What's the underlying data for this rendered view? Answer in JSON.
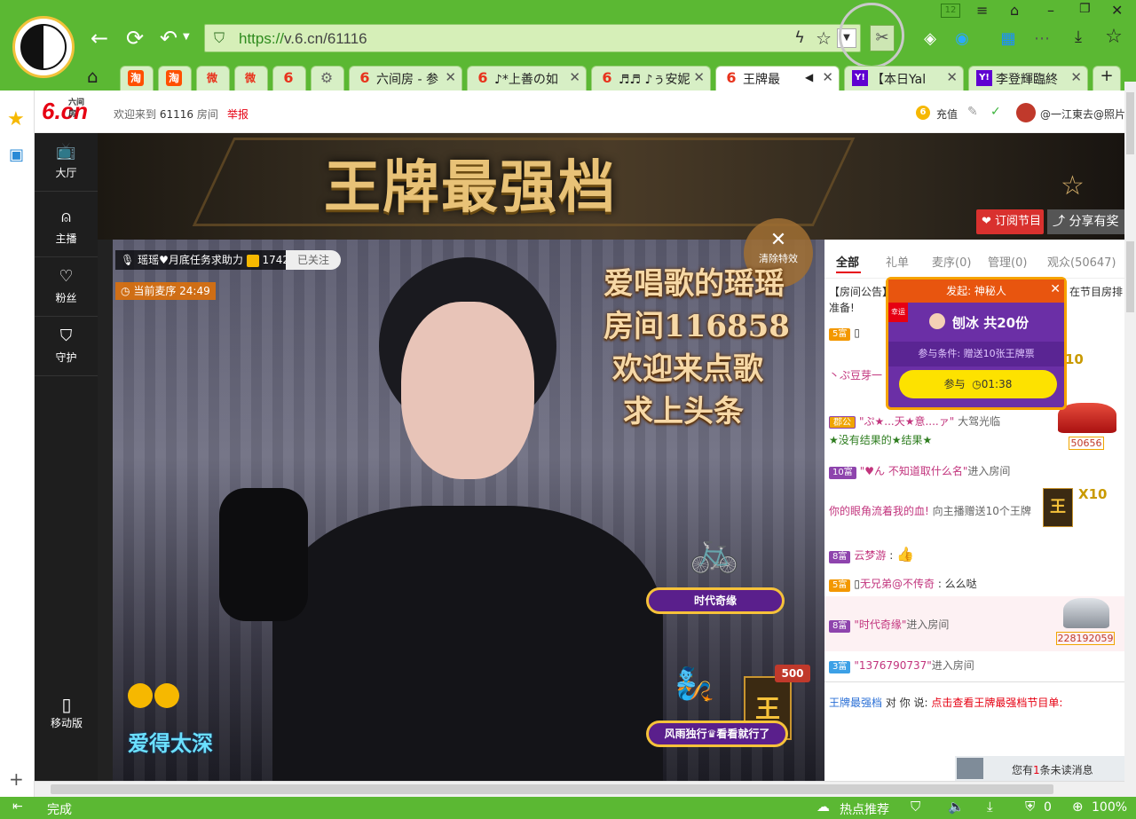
{
  "browser": {
    "url_scheme": "https://",
    "url_rest": "v.6.cn/61116",
    "corner_badge": "12",
    "tabs": [
      {
        "favicon": "淘",
        "title": ""
      },
      {
        "favicon": "淘",
        "title": ""
      },
      {
        "favicon": "微",
        "title": ""
      },
      {
        "favicon": "微",
        "title": ""
      },
      {
        "favicon": "6",
        "title": ""
      },
      {
        "favicon": "gear",
        "title": ""
      },
      {
        "favicon": "6",
        "title": "六间房 - 参"
      },
      {
        "favicon": "6",
        "title": "♪*上善の如"
      },
      {
        "favicon": "6",
        "title": "♬♬ ♪ぅ安妮"
      },
      {
        "favicon": "6",
        "title": "王牌最"
      },
      {
        "favicon": "Y!",
        "title": "【本日Yal"
      },
      {
        "favicon": "Y!",
        "title": "李登輝臨終"
      }
    ],
    "new_tab": "+",
    "status_text": "完成",
    "status_hot": "热点推荐",
    "status_count": "0",
    "zoom": "100%"
  },
  "site": {
    "logo_text": "6.cn",
    "logo_sub": "六间房",
    "welcome_prefix": "欢迎来到",
    "room_id": "61116",
    "welcome_suffix": "房间",
    "report": "举报",
    "recharge": "充值",
    "username": "@一江東去@照片"
  },
  "sidenav": [
    {
      "label": "大厅",
      "icon": "tv-icon"
    },
    {
      "label": "主播",
      "icon": "anchor-icon"
    },
    {
      "label": "粉丝",
      "icon": "heart-icon"
    },
    {
      "label": "守护",
      "icon": "shield-icon"
    }
  ],
  "mobile_label": "移动版",
  "banner": {
    "title": "王牌最强档",
    "subscribe": "订阅节目",
    "share": "分享有奖"
  },
  "video": {
    "host_name": "瑶瑶♥月底任务求助力",
    "coin_count": "1742",
    "follow_status": "已关注",
    "queue_timer": "当前麦序 24:49",
    "clear_effects": "清除特效",
    "overlay_lines": [
      "爱唱歌的瑶瑶",
      "房间116858",
      "欢迎来点歌",
      "求上头条"
    ],
    "tag_1": "时代奇缘",
    "tag_2": "风雨独行♛看看就行了",
    "gift_count": "500",
    "caption": "爱得太深"
  },
  "chat": {
    "tabs": [
      {
        "label": "全部",
        "active": true
      },
      {
        "label": "礼单",
        "active": false
      },
      {
        "label": "麦序(0)",
        "active": false
      },
      {
        "label": "管理(0)",
        "active": false
      },
      {
        "label": "观众(50647)",
        "active": false
      }
    ],
    "announcement_a": "【房间公告】",
    "announcement_b": "在节目房排",
    "announcement_c": "准备!",
    "popup": {
      "title": "发起: 神秘人",
      "corner": "幸运",
      "prize": "刨冰 共20份",
      "condition": "参与条件: 赠送10张王牌票",
      "button": "参与",
      "timer": "01:38"
    },
    "rows": [
      {
        "badge": "5富",
        "badge_color": "#f39800",
        "text": "",
        "extra": ""
      },
      {
        "badge": "",
        "text": "丶ぷ豆芽一",
        "extra": "10"
      },
      {
        "badge": "郡公",
        "badge_color": "#f0a500",
        "user": "\"ぷ★...天★意....ァ\"",
        "text": "大驾光临",
        "line2": "★没有结果的★结果★",
        "car_num": "50656"
      },
      {
        "badge": "10富",
        "badge_color": "#8e44ad",
        "user": "\"♥ん 不知道取什么名\"",
        "text": "进入房间"
      },
      {
        "user": "你的眼角流着我的血!",
        "text": "向主播赠送10个王牌",
        "extra": "X10"
      },
      {
        "badge": "8富",
        "badge_color": "#8e44ad",
        "user": "云梦游",
        "text": ":"
      },
      {
        "badge": "5富",
        "badge_color": "#f39800",
        "user": "无兄弟@不传奇",
        "text": ":  么么哒"
      },
      {
        "badge": "8富",
        "badge_color": "#8e44ad",
        "user": "\"时代奇缘\"",
        "text": "进入房间",
        "car_num": "228192059"
      },
      {
        "badge": "3富",
        "badge_color": "#3ca0e6",
        "user": "\"1376790737\"",
        "text": "进入房间"
      }
    ],
    "bottom_user": "王牌最强档",
    "bottom_mid": "对 你 说:",
    "bottom_link": "点击查看王牌最强档节目单:",
    "unread_prefix": "您有",
    "unread_count": "1",
    "unread_suffix": "条未读消息"
  }
}
